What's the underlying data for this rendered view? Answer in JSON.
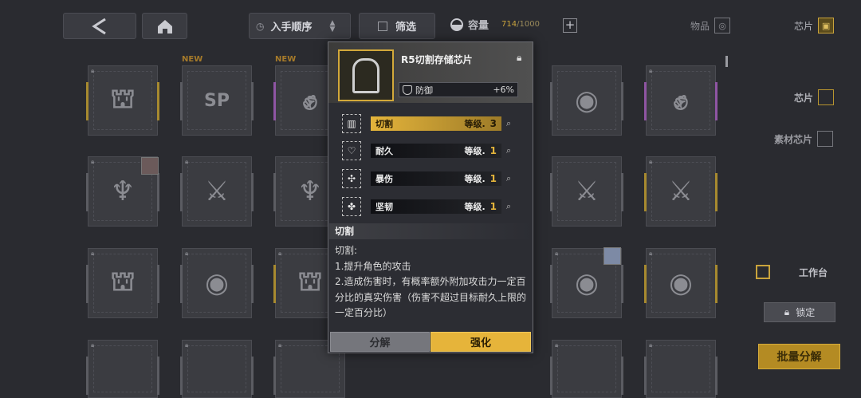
{
  "topbar": {
    "sort_label": "入手顺序",
    "filter_label": "筛选",
    "capacity_label": "容量",
    "capacity_used": "714",
    "capacity_total": "/1000",
    "plus_symbol": "+"
  },
  "tabs": {
    "items_label": "物品",
    "chips_label": "芯片"
  },
  "grid": {
    "new_tag": "NEW",
    "sp_text": "SP"
  },
  "sidebar": {
    "chip_label": "芯片",
    "material_chip_label": "素材芯片",
    "workbench_label": "工作台",
    "lock_label": "锁定",
    "bulk_dismantle_label": "批量分解"
  },
  "popup": {
    "title": "R5切割存储芯片",
    "main_stat": {
      "name": "防御",
      "value": "+6%"
    },
    "level_label": "等级.",
    "substats": [
      {
        "name": "切割",
        "level": "3",
        "highlight": true
      },
      {
        "name": "耐久",
        "level": "1",
        "highlight": false
      },
      {
        "name": "暴伤",
        "level": "1",
        "highlight": false
      },
      {
        "name": "坚韧",
        "level": "1",
        "highlight": false
      }
    ],
    "desc_title": "切割",
    "desc_lines": [
      "切割:",
      "1.提升角色的攻击",
      "2.造成伤害时，有概率额外附加攻击力一定百分比的真实伤害（伤害不超过目标耐久上限的一定百分比）"
    ],
    "dismantle_label": "分解",
    "enhance_label": "强化"
  }
}
